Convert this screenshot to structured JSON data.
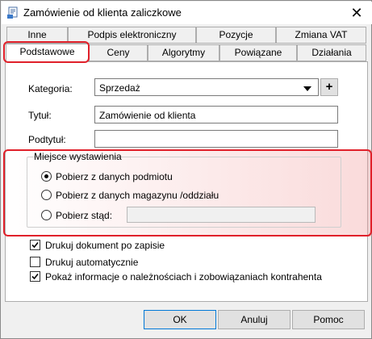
{
  "window": {
    "title": "Zamówienie od klienta zaliczkowe",
    "close_glyph": "✕"
  },
  "tabs_row1": [
    {
      "label": "Inne"
    },
    {
      "label": "Podpis elektroniczny"
    },
    {
      "label": "Pozycje"
    },
    {
      "label": "Zmiana VAT"
    }
  ],
  "tabs_row2": [
    {
      "label": "Podstawowe",
      "active": true
    },
    {
      "label": "Ceny"
    },
    {
      "label": "Algorytmy"
    },
    {
      "label": "Powiązane"
    },
    {
      "label": "Działania"
    }
  ],
  "form": {
    "kategoria_label": "Kategoria:",
    "kategoria_value": "Sprzedaż",
    "add_glyph": "+",
    "tytul_label": "Tytuł:",
    "tytul_value": "Zamówienie od klienta",
    "podtytul_label": "Podtytuł:",
    "podtytul_value": ""
  },
  "miejsce": {
    "legend": "Miejsce wystawienia",
    "options": [
      {
        "label": "Pobierz z danych podmiotu",
        "selected": true
      },
      {
        "label": "Pobierz z danych magazynu /oddziału",
        "selected": false
      },
      {
        "label": "Pobierz stąd:",
        "selected": false
      }
    ],
    "stad_value": ""
  },
  "checkboxes": [
    {
      "label": "Drukuj dokument po zapisie",
      "checked": true
    },
    {
      "label": "Drukuj automatycznie",
      "checked": false
    },
    {
      "label": "Pokaż informacje o należnościach i zobowiązaniach kontrahenta",
      "checked": true
    }
  ],
  "buttons": {
    "ok": "OK",
    "cancel": "Anuluj",
    "help": "Pomoc"
  },
  "colors": {
    "highlight": "#e0202a",
    "window_bg": "#f0f0f0",
    "panel_bg": "#ffffff"
  },
  "icons": {
    "app": "document-app-icon",
    "close": "close-icon",
    "dropdown": "chevron-down-icon",
    "check": "check-icon"
  }
}
